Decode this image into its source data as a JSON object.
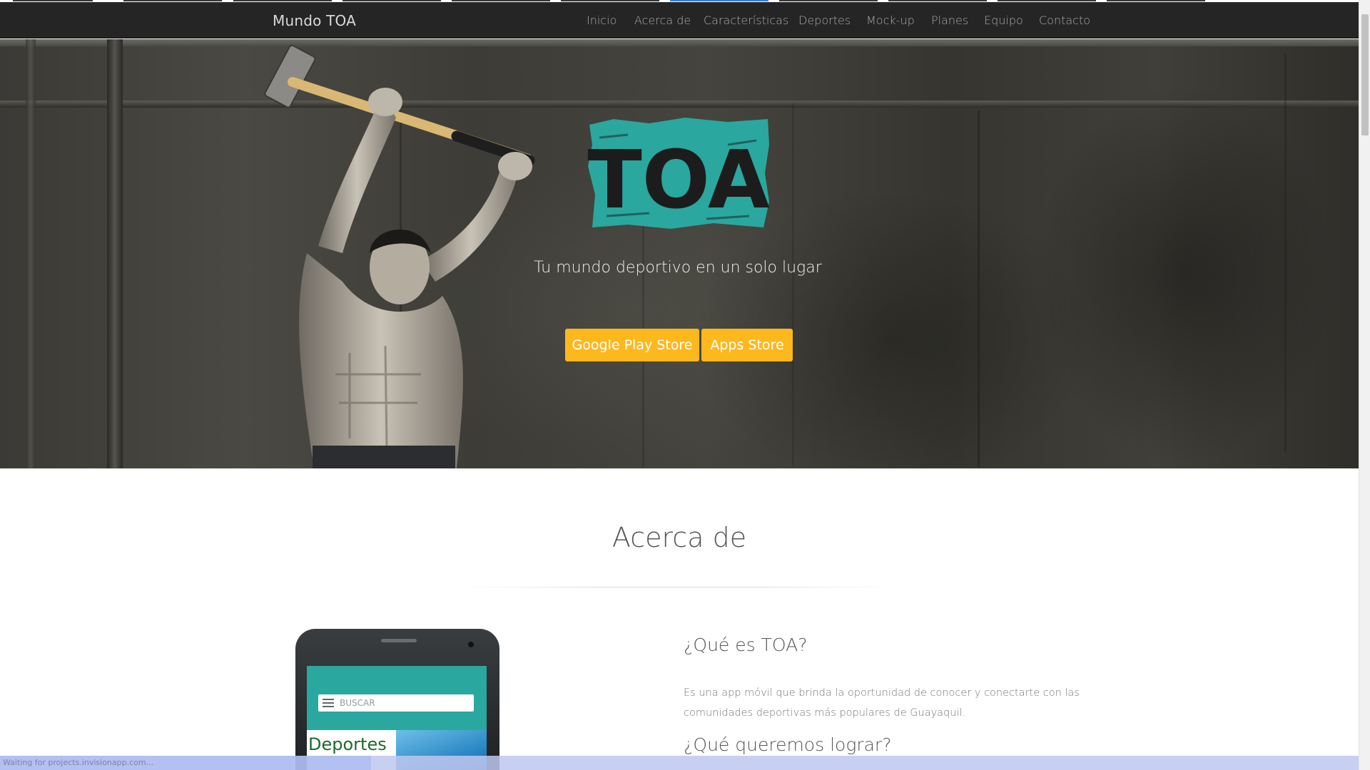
{
  "navbar": {
    "brand": "Mundo TOA",
    "links": [
      "Inicio",
      "Acerca de",
      "Características",
      "Deportes",
      "Mock-up",
      "Planes",
      "Equipo",
      "Contacto"
    ]
  },
  "hero": {
    "logo_text": "TOA",
    "tagline": "Tu mundo deportivo en un solo lugar",
    "buttons": {
      "google_play": "Google Play Store",
      "apps_store": "Apps Store"
    }
  },
  "about": {
    "title": "Acerca de",
    "phone": {
      "search_placeholder": "BUSCAR",
      "heading": "Deportes"
    },
    "what_is_title": "¿Qué es TOA?",
    "what_is_text": "Es una app móvil que brinda la oportunidad de conocer y conectarte con las comunidades deportivas más populares de Guayaquil.",
    "goal_title": "¿Qué queremos lograr?"
  },
  "status_bar": {
    "text": "Waiting for projects.invisionapp.com..."
  },
  "colors": {
    "navbar_bg": "#252525",
    "button_yellow": "#fdb81e",
    "logo_teal": "#2aa79f"
  }
}
